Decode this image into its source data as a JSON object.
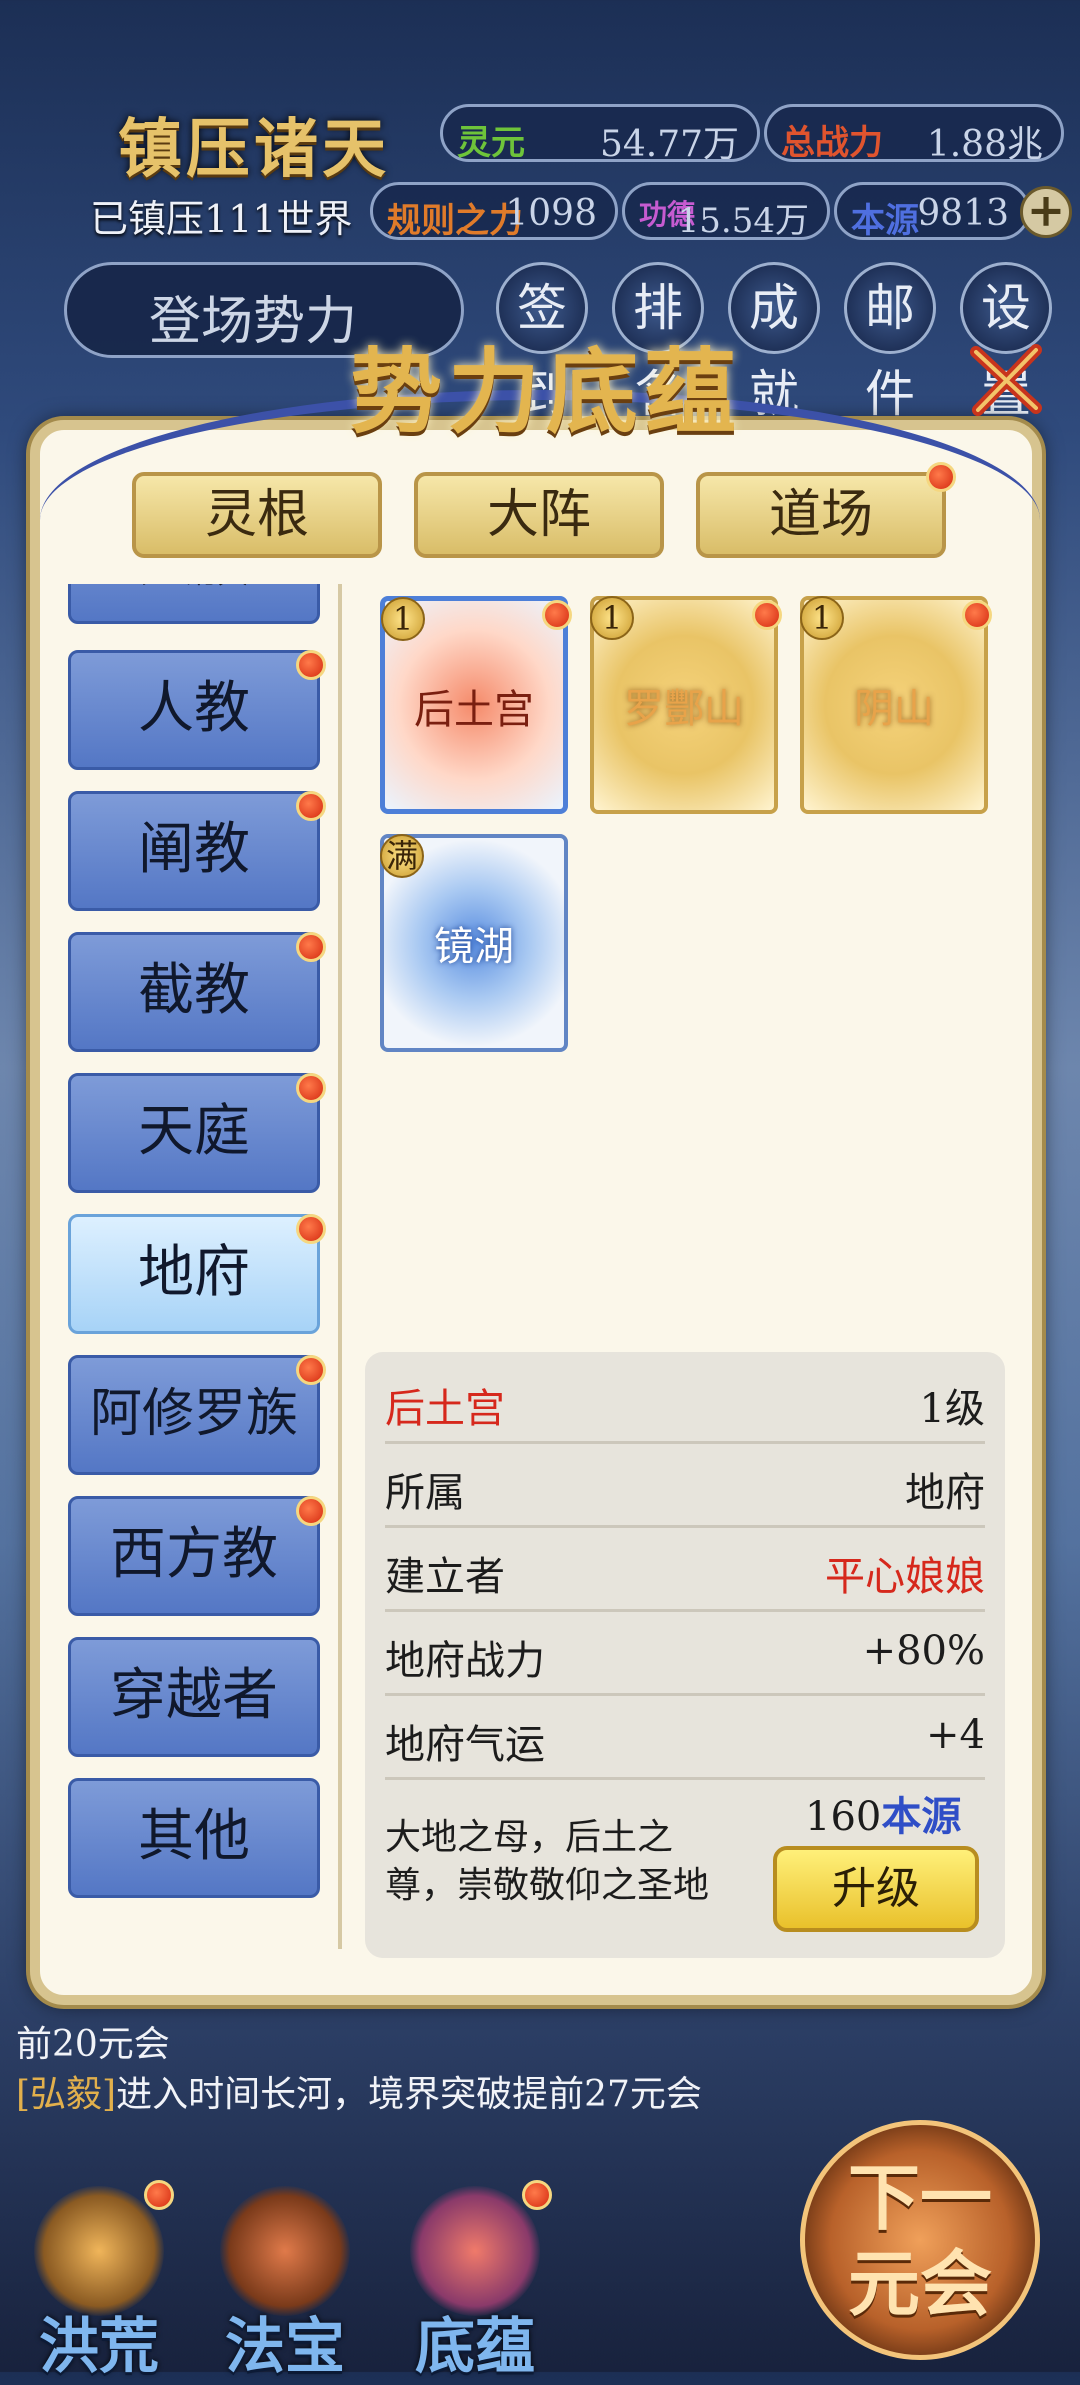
{
  "header": {
    "title": "镇压诸天",
    "world_status": "已镇压111世界",
    "stats": [
      {
        "label": "灵元",
        "value": "54.77万",
        "label_color": "#6ec43a"
      },
      {
        "label": "总战力",
        "value": "1.88兆",
        "label_color": "#e0542e"
      },
      {
        "label": "规则之力",
        "value": "1098",
        "label_color": "#e07b2a"
      },
      {
        "label": "功德",
        "value": "15.54万",
        "label_color": "#c65bd1"
      },
      {
        "label": "本源",
        "value": "9813",
        "label_color": "#4f6fe0"
      }
    ],
    "plus_label": "+",
    "enter_label": "登场势力",
    "menu": [
      "签到",
      "排名",
      "成就",
      "邮件",
      "设置"
    ]
  },
  "modal": {
    "title": "势力底蕴",
    "tabs": [
      "灵根",
      "大阵",
      "道场"
    ],
    "sidebar": [
      "人族",
      "人教",
      "阐教",
      "截教",
      "天庭",
      "地府",
      "阿修罗族",
      "西方教",
      "穿越者",
      "其他"
    ],
    "active_sidebar": "地府",
    "cards": [
      {
        "name": "后土宫",
        "badge": "1"
      },
      {
        "name": "罗酆山",
        "badge": "1"
      },
      {
        "name": "阴山",
        "badge": "1"
      },
      {
        "name": "镜湖",
        "badge": "满"
      }
    ],
    "detail": {
      "name": "后土宫",
      "level": "1级",
      "rows": [
        {
          "key": "所属",
          "value": "地府"
        },
        {
          "key": "建立者",
          "value": "平心娘娘"
        },
        {
          "key": "地府战力",
          "value": "+80%"
        },
        {
          "key": "地府气运",
          "value": "+4"
        }
      ],
      "description": "大地之母，后土之尊，崇敬敬仰之圣地",
      "cost_amount": "160",
      "cost_unit": "本源",
      "upgrade_label": "升级"
    }
  },
  "log": {
    "line1": "前20元会",
    "hero": "[弘毅]",
    "line2": "进入时间长河，境界突破提前27元会"
  },
  "bottom_nav": [
    "洪荒",
    "法宝",
    "底蕴"
  ],
  "next_label_1": "下一",
  "next_label_2": "元会"
}
